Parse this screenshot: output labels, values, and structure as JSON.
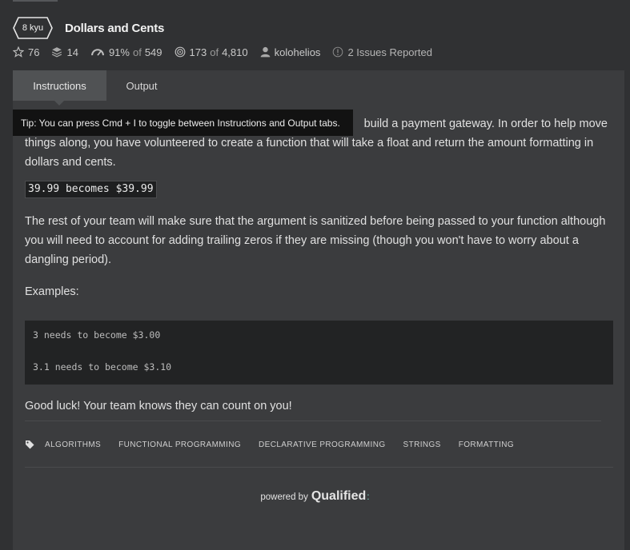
{
  "kata": {
    "rank": "8 kyu",
    "title": "Dollars and Cents"
  },
  "stats": {
    "stars": "76",
    "collections": "14",
    "satisfaction_pct": "91%",
    "of_word": "of",
    "satisfaction_votes": "549",
    "completed": "173",
    "completed_total": "4,810",
    "author": "kolohelios",
    "issues": "2 Issues Reported"
  },
  "tabs": {
    "instructions": "Instructions",
    "output": "Output"
  },
  "tooltip": "Tip: You can press Cmd + I to toggle between Instructions and Output tabs.",
  "description": {
    "p1_line1_tail": "build a payment gateway. In order to help move",
    "p1_line2": "things along, you have volunteered to create a function that will take a float and return the amount formatting in",
    "p1_line3": "dollars and cents.",
    "inline_example": "39.99 becomes $39.99",
    "p2_line1": "The rest of your team will make sure that the argument is sanitized before being passed to your function although",
    "p2_line2": "you will need to account for adding trailing zeros if they are missing (though you won't have to worry about a",
    "p2_line3": "dangling period).",
    "examples_label": "Examples:",
    "code_lines": [
      "3 needs to become $3.00",
      "3.1 needs to become $3.10"
    ],
    "closing": "Good luck! Your team knows they can count on you!"
  },
  "tags": [
    "ALGORITHMS",
    "FUNCTIONAL PROGRAMMING",
    "DECLARATIVE PROGRAMMING",
    "STRINGS",
    "FORMATTING"
  ],
  "footer": {
    "powered_by": "powered by",
    "brand": "Qualified",
    "brand_dots": ":"
  },
  "colors": {
    "background": "#303133",
    "panel": "#3b3c3e",
    "active_tab": "#505254",
    "tooltip": "#121212",
    "code_bg": "#222324"
  },
  "icons": [
    "star-icon",
    "layers-icon",
    "speedometer-icon",
    "target-icon",
    "user-icon",
    "issue-icon",
    "tag-icon"
  ]
}
